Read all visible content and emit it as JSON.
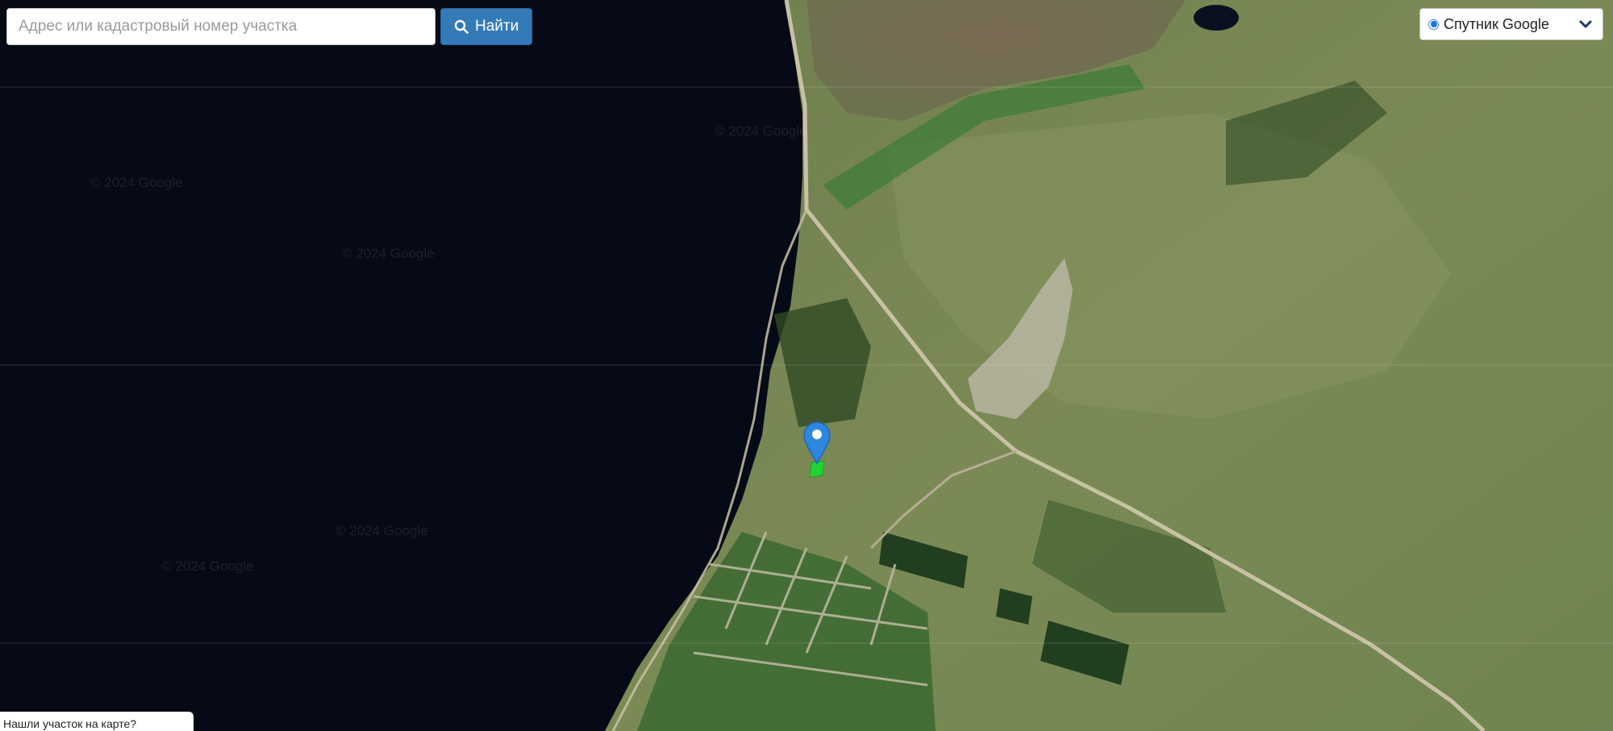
{
  "search": {
    "placeholder": "Адрес или кадастровый номер участка",
    "value": "",
    "button_label": "Найти",
    "button_icon": "search-icon"
  },
  "layer_select": {
    "selected": "Спутник Google",
    "icon": "chevron-down-icon"
  },
  "map": {
    "watermark": "© 2024 Google",
    "marker_icon": "map-pin-icon",
    "parcel_color": "#22d133",
    "marker_color": "#2e86de",
    "road_color": "#c9c1a4",
    "water_color": "#060a16"
  },
  "bottom_hint": "Нашли участок на карте?"
}
